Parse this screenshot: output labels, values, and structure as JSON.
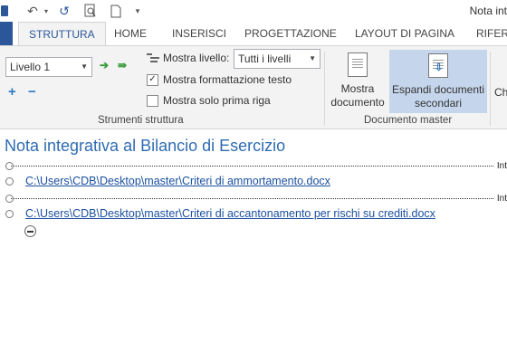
{
  "window": {
    "title": "Nota int"
  },
  "qat": {
    "undo_icon": "undo-icon",
    "redo_icon": "redo-icon",
    "preview_icon": "print-preview-icon",
    "new_icon": "new-document-icon",
    "customize_icon": "customize-qat-icon"
  },
  "tabs": [
    "STRUTTURA",
    "HOME",
    "INSERISCI",
    "PROGETTAZIONE",
    "LAYOUT DI PAGINA",
    "RIFERI"
  ],
  "ribbon": {
    "outline_tools": {
      "level_value": "Livello 1",
      "show_level_label": "Mostra livello:",
      "show_level_value": "Tutti i livelli",
      "show_text_formatting": "Mostra formattazione testo",
      "show_text_formatting_checked": true,
      "show_first_line_only": "Mostra solo prima riga",
      "show_first_line_only_checked": false,
      "label": "Strumenti struttura"
    },
    "master_document": {
      "show_document": [
        "Mostra",
        "documento"
      ],
      "expand_subdocuments": [
        "Espandi documenti",
        "secondari"
      ],
      "label": "Documento master"
    },
    "next_group_stub": "Ch"
  },
  "document": {
    "heading": "Nota integrativa al Bilancio di Esercizio",
    "break_label": "Int",
    "subdocuments": [
      "C:\\Users\\CDB\\Desktop\\master\\Criteri di ammortamento.docx",
      "C:\\Users\\CDB\\Desktop\\master\\Criteri di accantonamento per rischi su crediti.docx"
    ]
  },
  "colors": {
    "accent": "#2b579a",
    "heading": "#2f6bb3",
    "link": "#1a4fa0",
    "pressed": "#c5d6ec"
  }
}
